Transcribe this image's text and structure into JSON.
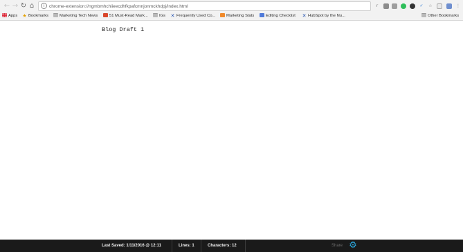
{
  "browser": {
    "url": "chrome-extension://ngmbmhchiieecdhfkpafcmnjonmckhdpj/index.html",
    "bookmarks": [
      {
        "label": "Apps",
        "icon": "apps-grid-icon"
      },
      {
        "label": "Bookmarks",
        "icon": "star-icon"
      },
      {
        "label": "Marketing Tech News",
        "icon": "folder-icon"
      },
      {
        "label": "51 Must-Read Mark...",
        "icon": "red-square-icon"
      },
      {
        "label": "IGs",
        "icon": "folder-icon"
      },
      {
        "label": "Frequently Used Co...",
        "icon": "x-icon"
      },
      {
        "label": "Marketing Stats",
        "icon": "orange-icon"
      },
      {
        "label": "Editing Checklist",
        "icon": "doc-icon"
      },
      {
        "label": "HubSpot by the Nu...",
        "icon": "x-icon"
      }
    ],
    "other_bookmarks": "Other Bookmarks"
  },
  "editor": {
    "text": "Blog Draft 1"
  },
  "footer": {
    "last_saved": "Last Saved: 1/11/2016 @ 12:11",
    "lines": "Lines: 1",
    "characters": "Characters: 12",
    "share": "Share"
  },
  "colors": {
    "footer_bg": "#1a1a1a",
    "gear": "#2aa3d8"
  }
}
